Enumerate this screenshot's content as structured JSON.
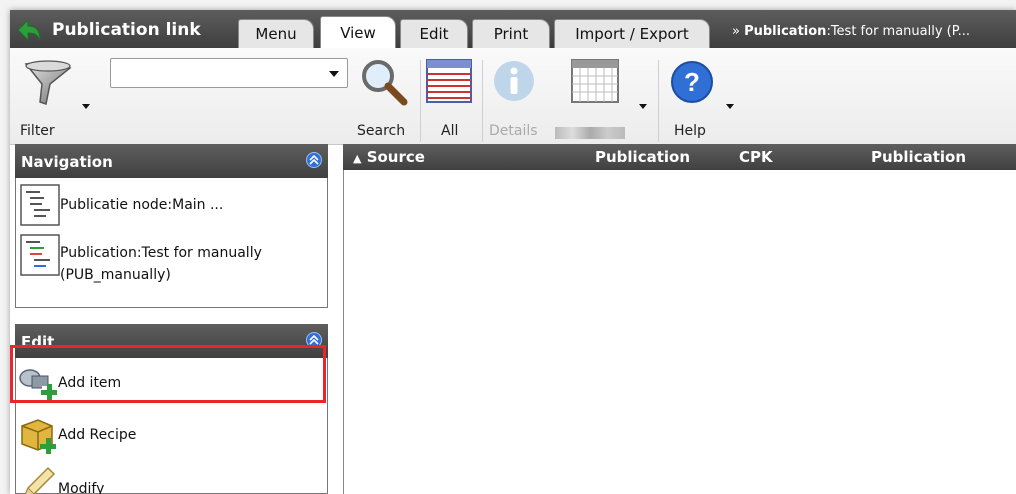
{
  "app": {
    "title": "Publication link"
  },
  "tabs": [
    {
      "label": "Menu",
      "active": false
    },
    {
      "label": "View",
      "active": true
    },
    {
      "label": "Edit",
      "active": false
    },
    {
      "label": "Print",
      "active": false
    },
    {
      "label": "Import / Export",
      "active": false
    }
  ],
  "breadcrumb": {
    "prefix": "» ",
    "strong": "Publication",
    "rest": ":Test for manually (P..."
  },
  "toolbar": {
    "filter_label": "Filter",
    "search_value": "",
    "search_label": "Search",
    "all_label": "All",
    "details_label": "Details",
    "help_label": "Help"
  },
  "navigation": {
    "title": "Navigation",
    "items": [
      {
        "label": "Publicatie node:Main ..."
      },
      {
        "label": "Publication:Test for manually (PUB_manually)"
      }
    ]
  },
  "edit": {
    "title": "Edit",
    "items": [
      {
        "label": "Add item",
        "highlighted": true
      },
      {
        "label": "Add Recipe"
      },
      {
        "label": "Modify"
      }
    ]
  },
  "grid": {
    "columns": [
      "Source",
      "Publication",
      "CPK",
      "Publication"
    ],
    "sort_indicator": "▲",
    "rows": []
  },
  "colors": {
    "accent_blue": "#2f6fd6",
    "highlight_red": "#e8262b",
    "header_dark": "#404040",
    "back_green": "#2e9e3c"
  }
}
